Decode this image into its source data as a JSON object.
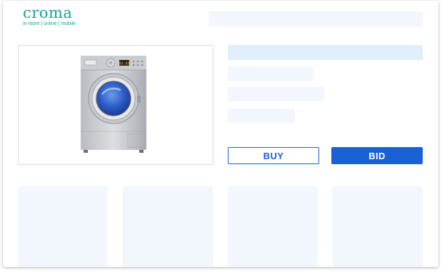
{
  "brand": {
    "name": "croma",
    "tagline": "in-store | online | mobile",
    "color": "#12a39a"
  },
  "product": {
    "image_icon": "washing-machine-icon",
    "display_readout": "88:88"
  },
  "actions": {
    "buy_label": "BUY",
    "bid_label": "BID",
    "accent_color": "#1a61d6"
  },
  "loading": {
    "skeleton_color": "#f2f7fd"
  }
}
